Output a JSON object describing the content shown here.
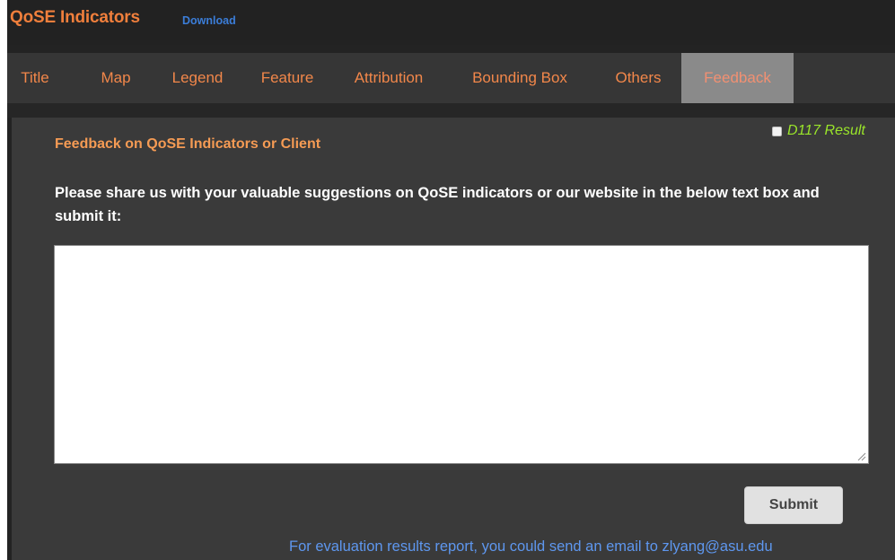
{
  "header": {
    "title": "QoSE Indicators",
    "download_label": "Download"
  },
  "tabs": [
    {
      "label": "Title"
    },
    {
      "label": "Map"
    },
    {
      "label": "Legend"
    },
    {
      "label": "Feature"
    },
    {
      "label": "Attribution"
    },
    {
      "label": "Bounding Box"
    },
    {
      "label": "Others"
    },
    {
      "label": "Feedback",
      "active": true
    }
  ],
  "result_toggle": {
    "label": "D117 Result",
    "checked": false
  },
  "feedback": {
    "heading": "Feedback on QoSE Indicators or Client",
    "prompt": "Please share us with your valuable suggestions on QoSE indicators or our website in the below text box and submit it:",
    "textarea_value": "",
    "submit_label": "Submit",
    "footer_note": "For evaluation results report, you could send an email to zlyang@asu.edu"
  },
  "colors": {
    "accent_orange": "#f07f3c",
    "link_blue": "#3b7dd8",
    "result_green": "#9ae52a",
    "active_tab_bg": "#8a8a8a"
  }
}
